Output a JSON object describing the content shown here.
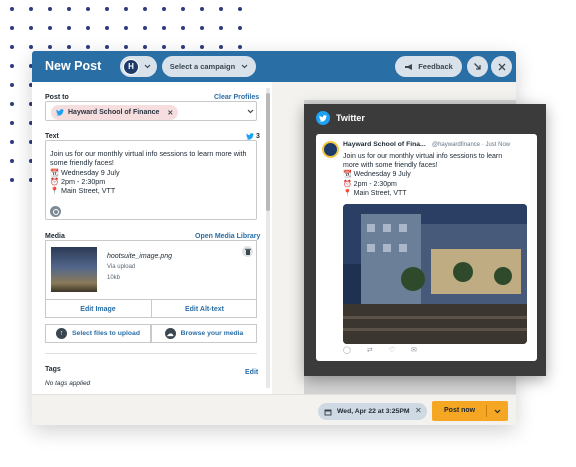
{
  "header": {
    "title": "New Post",
    "profile_initial": "H",
    "campaign_label": "Select a campaign",
    "feedback_label": "Feedback"
  },
  "post_to": {
    "label": "Post to",
    "clear_label": "Clear Profiles",
    "profile_chip": "Hayward School of Finance",
    "remove_glyph": "✕"
  },
  "text": {
    "label": "Text",
    "char_count": "3",
    "lines": [
      "Join us for our monthly virtual info sessions to learn more with",
      "some friendly faces!",
      "Wednesday 9 July",
      "2pm - 2:30pm",
      "Main Street, VTT"
    ]
  },
  "media": {
    "label": "Media",
    "open_library": "Open Media Library",
    "file_name": "hootsuite_image.png",
    "file_source": "Via upload",
    "file_size": "10kb",
    "edit_image": "Edit Image",
    "edit_alt": "Edit Alt-text",
    "select_files": "Select files to upload",
    "browse_media": "Browse your media"
  },
  "tags": {
    "label": "Tags",
    "edit_label": "Edit",
    "empty_text": "No tags applied"
  },
  "footer": {
    "schedule": "Wed, Apr 22 at 3:25PM",
    "clear_glyph": "✕",
    "post_now": "Post now"
  },
  "preview": {
    "network": "Twitter",
    "account_name": "Hayward School of Fina...",
    "handle": "@haywardfinance",
    "time": "Just Now",
    "lines": [
      "Join us for our monthly virtual info sessions to learn",
      "more with some friendly faces!",
      "Wednesday 9 July",
      "2pm - 2:30pm",
      "Main Street, VTT"
    ]
  },
  "colors": {
    "header_blue": "#2a6ea6",
    "link_blue": "#2a6ea6",
    "post_orange": "#f5a623",
    "twitter_blue": "#1da1f2"
  },
  "icons": [
    "twitter-icon",
    "calendar-icon",
    "alarm-clock-icon",
    "pin-icon",
    "emoji-icon",
    "trash-icon",
    "upload-icon",
    "cloud-icon",
    "minimize-icon",
    "close-icon",
    "megaphone-icon",
    "chevron-down-icon"
  ]
}
